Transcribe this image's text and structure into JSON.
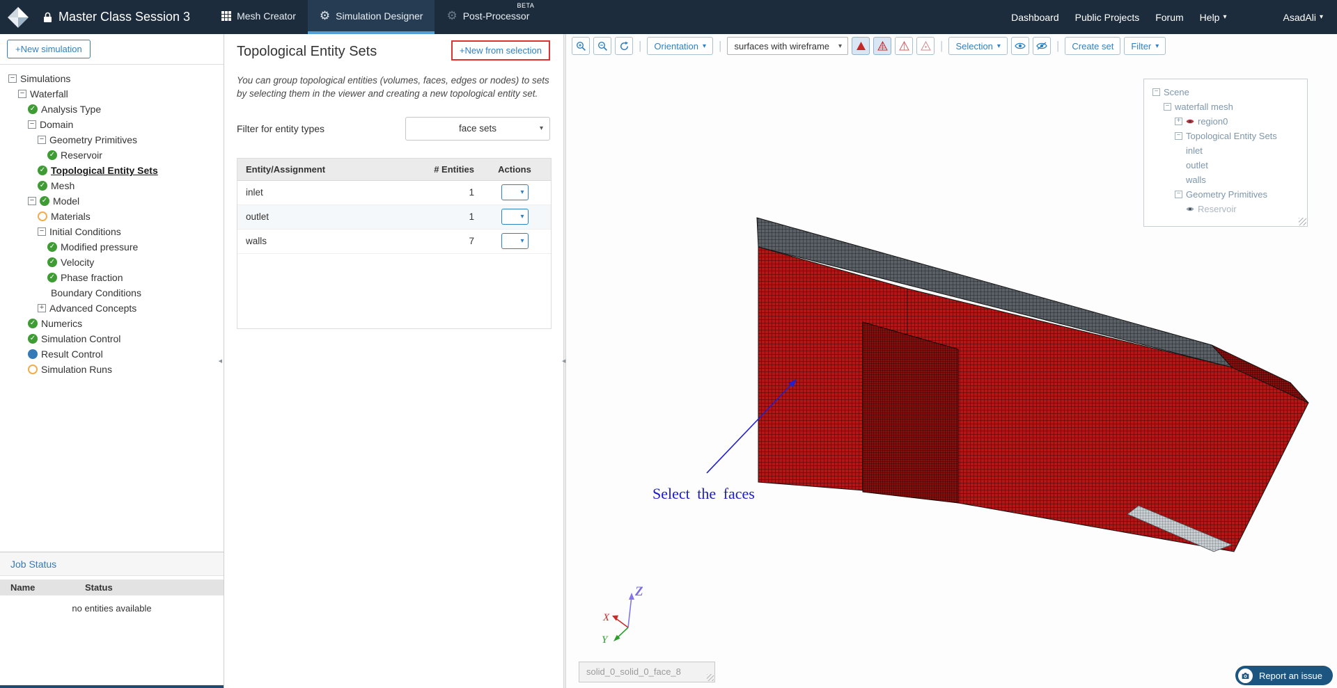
{
  "colors": {
    "navbar_bg": "#1c2c3c",
    "accent_blue": "#3080c0",
    "active_tab_underline": "#4f9fd9",
    "status_green": "#3f9c35",
    "status_orange": "#f0ad4e",
    "status_blue": "#337ab7",
    "highlight_red": "#e03131",
    "mesh_red": "#b51515",
    "mesh_dark_red": "#8c0f0f",
    "mesh_gray": "#5a6065",
    "annotation_blue": "#1a1aca"
  },
  "navbar": {
    "title": "Master Class Session 3",
    "tabs": [
      {
        "label": "Mesh Creator"
      },
      {
        "label": "Simulation Designer"
      },
      {
        "label": "Post-Processor",
        "badge": "BETA"
      }
    ],
    "links": {
      "dashboard": "Dashboard",
      "public_projects": "Public Projects",
      "forum": "Forum",
      "help": "Help",
      "user": "AsadAli"
    }
  },
  "sidebar": {
    "new_simulation": "+New simulation",
    "tree": [
      {
        "label": "Simulations",
        "level": 0,
        "collapse": "minus"
      },
      {
        "label": "Waterfall",
        "level": 1,
        "collapse": "minus"
      },
      {
        "label": "Analysis Type",
        "level": 2,
        "status": "check"
      },
      {
        "label": "Domain",
        "level": 2,
        "collapse": "minus"
      },
      {
        "label": "Geometry Primitives",
        "level": 3,
        "collapse": "minus"
      },
      {
        "label": "Reservoir",
        "level": 4,
        "status": "check"
      },
      {
        "label": "Topological Entity Sets",
        "level": 3,
        "status": "check",
        "selected": true
      },
      {
        "label": "Mesh",
        "level": 3,
        "status": "check"
      },
      {
        "label": "Model",
        "level": 2,
        "collapse": "minus",
        "status": "check"
      },
      {
        "label": "Materials",
        "level": 3,
        "status": "orange"
      },
      {
        "label": "Initial Conditions",
        "level": 3,
        "collapse": "minus"
      },
      {
        "label": "Modified pressure",
        "level": 4,
        "status": "check"
      },
      {
        "label": "Velocity",
        "level": 4,
        "status": "check"
      },
      {
        "label": "Phase fraction",
        "level": 4,
        "status": "check"
      },
      {
        "label": "Boundary Conditions",
        "level": 3,
        "status": "spacer"
      },
      {
        "label": "Advanced Concepts",
        "level": 3,
        "collapse": "plus"
      },
      {
        "label": "Numerics",
        "level": 2,
        "status": "check"
      },
      {
        "label": "Simulation Control",
        "level": 2,
        "status": "check"
      },
      {
        "label": "Result Control",
        "level": 2,
        "status": "blue"
      },
      {
        "label": "Simulation Runs",
        "level": 2,
        "status": "orange"
      }
    ],
    "job_status": {
      "title": "Job Status",
      "columns": [
        "Name",
        "Status"
      ],
      "empty": "no entities available"
    }
  },
  "panel": {
    "title": "Topological Entity Sets",
    "new_from_selection": "+New from selection",
    "description": "You can group topological entities (volumes, faces, edges or nodes) to sets by selecting them in the viewer and creating a new topological entity set.",
    "filter_label": "Filter for entity types",
    "filter_value": "face sets",
    "table": {
      "columns": [
        "Entity/Assignment",
        "# Entities",
        "Actions"
      ],
      "rows": [
        {
          "name": "inlet",
          "entities": "1"
        },
        {
          "name": "outlet",
          "entities": "1"
        },
        {
          "name": "walls",
          "entities": "7"
        }
      ]
    }
  },
  "viewer": {
    "toolbar": {
      "orientation": "Orientation",
      "render_mode": "surfaces with wireframe",
      "selection": "Selection",
      "create_set": "Create set",
      "filter": "Filter"
    },
    "scene_tree": [
      {
        "label": "Scene",
        "level": 0,
        "collapse": "minus"
      },
      {
        "label": "waterfall mesh",
        "level": 1,
        "collapse": "minus"
      },
      {
        "label": "region0",
        "level": 2,
        "collapse": "plus",
        "icon": "eye-red"
      },
      {
        "label": "Topological Entity Sets",
        "level": 2,
        "collapse": "minus"
      },
      {
        "label": "inlet",
        "level": 3
      },
      {
        "label": "outlet",
        "level": 3
      },
      {
        "label": "walls",
        "level": 3
      },
      {
        "label": "Geometry Primitives",
        "level": 2,
        "collapse": "minus"
      },
      {
        "label": "Reservoir",
        "level": 3,
        "icon": "eye-gray",
        "muted": true
      }
    ],
    "annotation": "Select the faces",
    "axes": {
      "x": "X",
      "y": "Y",
      "z": "Z"
    },
    "tooltip": "solid_0_solid_0_face_8",
    "report_issue": "Report an issue"
  }
}
